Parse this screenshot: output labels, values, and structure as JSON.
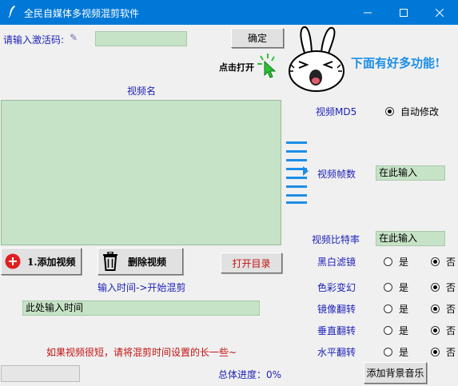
{
  "window": {
    "title": "全民自媒体多视频混剪软件",
    "icon": "feather-icon"
  },
  "activation": {
    "label": "请输入激活码:",
    "value": "",
    "confirm_label": "确定"
  },
  "promo": {
    "click_open": "点击打开",
    "more_features": "下面有好多功能!"
  },
  "video_list": {
    "header": "视频名",
    "items": []
  },
  "buttons": {
    "add_video": "1.添加视频",
    "delete_video": "删除视频",
    "open_dir": "打开目录",
    "add_music": "添加背景音乐"
  },
  "time": {
    "label": "输入时间->开始混剪",
    "value": "此处输入时间",
    "warning": "如果视频很短，请将混剪时间设置的长一些~"
  },
  "progress": {
    "label": "总体进度：0%",
    "value": 0
  },
  "settings": {
    "md5": {
      "label": "视频MD5",
      "option": "自动修改",
      "selected": true
    },
    "fps": {
      "label": "视频帧数",
      "value": "在此输入"
    },
    "bitrate": {
      "label": "视频比特率",
      "value": "在此输入"
    },
    "yes": "是",
    "no": "否",
    "toggles": [
      {
        "label": "黑白滤镜",
        "value": "否"
      },
      {
        "label": "色彩变幻",
        "value": "否"
      },
      {
        "label": "镜像翻转",
        "value": "否"
      },
      {
        "label": "垂直翻转",
        "value": "否"
      },
      {
        "label": "水平翻转",
        "value": "否"
      }
    ]
  },
  "colors": {
    "titlebar": "#0078d7",
    "label_blue": "#1f22b8",
    "warning_red": "#c41010",
    "entry_green": "#c7e3c7",
    "accent_blue": "#1b8ee8"
  }
}
